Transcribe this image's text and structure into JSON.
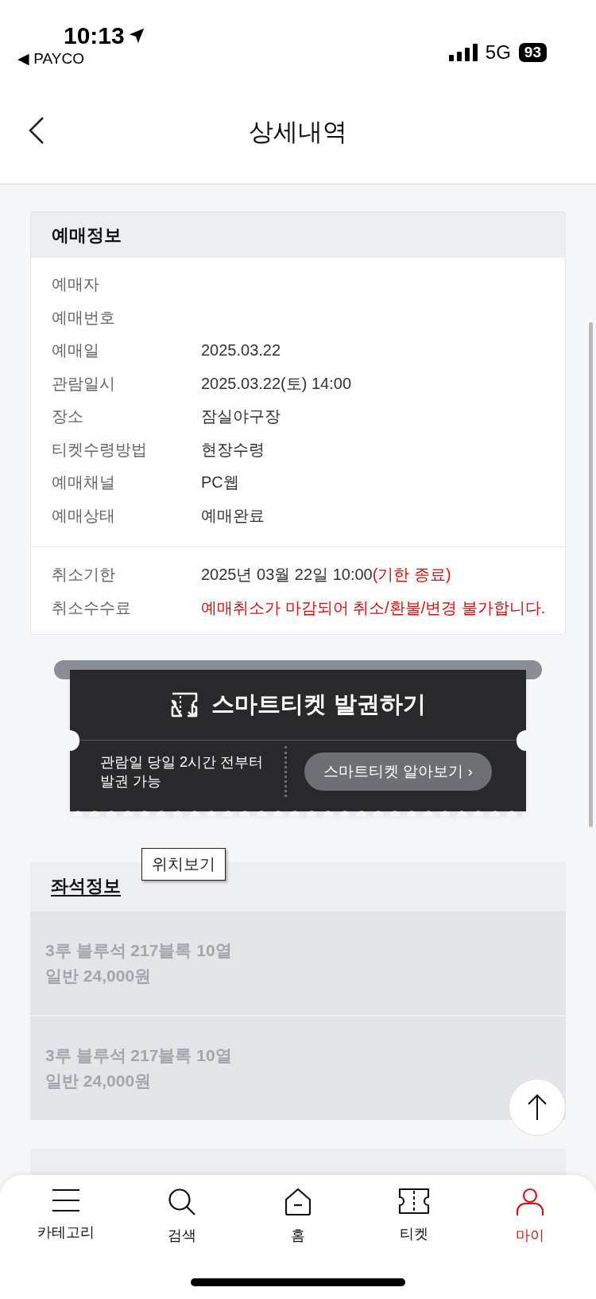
{
  "status_bar": {
    "time": "10:13",
    "back_app": "◀ PAYCO",
    "network": "5G",
    "battery": "93"
  },
  "header": {
    "title": "상세내역"
  },
  "booking": {
    "title": "예매정보",
    "rows": [
      {
        "label": "예매자"
      },
      {
        "label": "예매번호"
      },
      {
        "label": "예매일",
        "value": "2025.03.22"
      },
      {
        "label": "관람일시",
        "value": "2025.03.22(토) 14:00"
      },
      {
        "label": "장소",
        "value": "잠실야구장"
      },
      {
        "label": "티켓수령방법",
        "value": "현장수령"
      },
      {
        "label": "예매채널",
        "value": "PC웹"
      },
      {
        "label": "예매상태",
        "value": "예매완료"
      }
    ],
    "cancel_rows": [
      {
        "label": "취소기한",
        "value": "2025년 03월 22일 10:00",
        "note": "(기한 종료)",
        "alert": false
      },
      {
        "label": "취소수수료",
        "value": "예매취소가 마감되어 취소/환불/변경 불가합니다.",
        "alert": true
      }
    ]
  },
  "smart_ticket": {
    "title": "스마트티켓 발권하기",
    "info": "관람일 당일 2시간 전부터\n발권 가능",
    "button": "스마트티켓 알아보기 ›"
  },
  "seats": {
    "title": "좌석정보",
    "tooltip": "위치보기",
    "items": [
      {
        "seat": "3루 블루석 217블록 10열",
        "price": "일반 24,000원",
        "disabled": true
      },
      {
        "seat": "3루 블루석 217블록 10열",
        "price": "일반 24,000원",
        "disabled": true
      }
    ]
  },
  "nav": [
    {
      "label": "카테고리",
      "kind": "menu",
      "selected": false
    },
    {
      "label": "검색",
      "kind": "search",
      "selected": false
    },
    {
      "label": "홈",
      "kind": "home",
      "selected": false
    },
    {
      "label": "티켓",
      "kind": "ticket",
      "selected": false
    },
    {
      "label": "마이",
      "kind": "person",
      "selected": true
    }
  ]
}
